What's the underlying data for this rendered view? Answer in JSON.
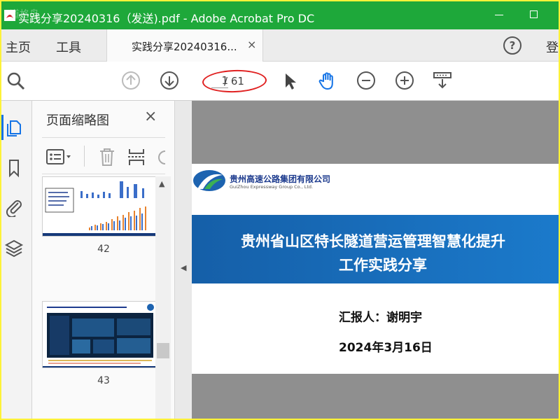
{
  "window": {
    "title": "实践分享20240316（发送).pdf - Adobe Acrobat Pro DC",
    "watermark": "道格岛",
    "colors": {
      "titlebar": "#1ea83a",
      "accent": "#1473e6",
      "annotation": "#e02020"
    }
  },
  "menu": {
    "home": "主页",
    "tools": "工具",
    "tab_label": "实践分享20240316...",
    "tab_close": "×",
    "help": "?",
    "login": "登"
  },
  "toolbar": {
    "icons": [
      "search-icon",
      "page-up-icon",
      "page-down-icon",
      "select-cursor-icon",
      "hand-tool-icon",
      "zoom-out-icon",
      "zoom-in-icon",
      "scroll-mode-icon"
    ],
    "current_page": "1",
    "total_pages": "/ 61"
  },
  "nav": {
    "icons": [
      "pages-icon",
      "bookmark-icon",
      "attachment-icon",
      "layers-icon"
    ]
  },
  "thumbnails": {
    "title": "页面缩略图",
    "close": "×",
    "tools": [
      "page-options-icon",
      "delete-icon",
      "insert-page-icon",
      "rotate-icon"
    ],
    "items": [
      {
        "number": "42"
      },
      {
        "number": "43"
      }
    ]
  },
  "document": {
    "company_cn": "贵州高速公路集团有限公司",
    "company_en": "GuiZhou Expressway Group Co., Ltd.",
    "title_line1": "贵州省山区特长隧道营运管理智慧化提升",
    "title_line2": "工作实践分享",
    "reporter": "汇报人：谢明宇",
    "date": "2024年3月16日"
  }
}
